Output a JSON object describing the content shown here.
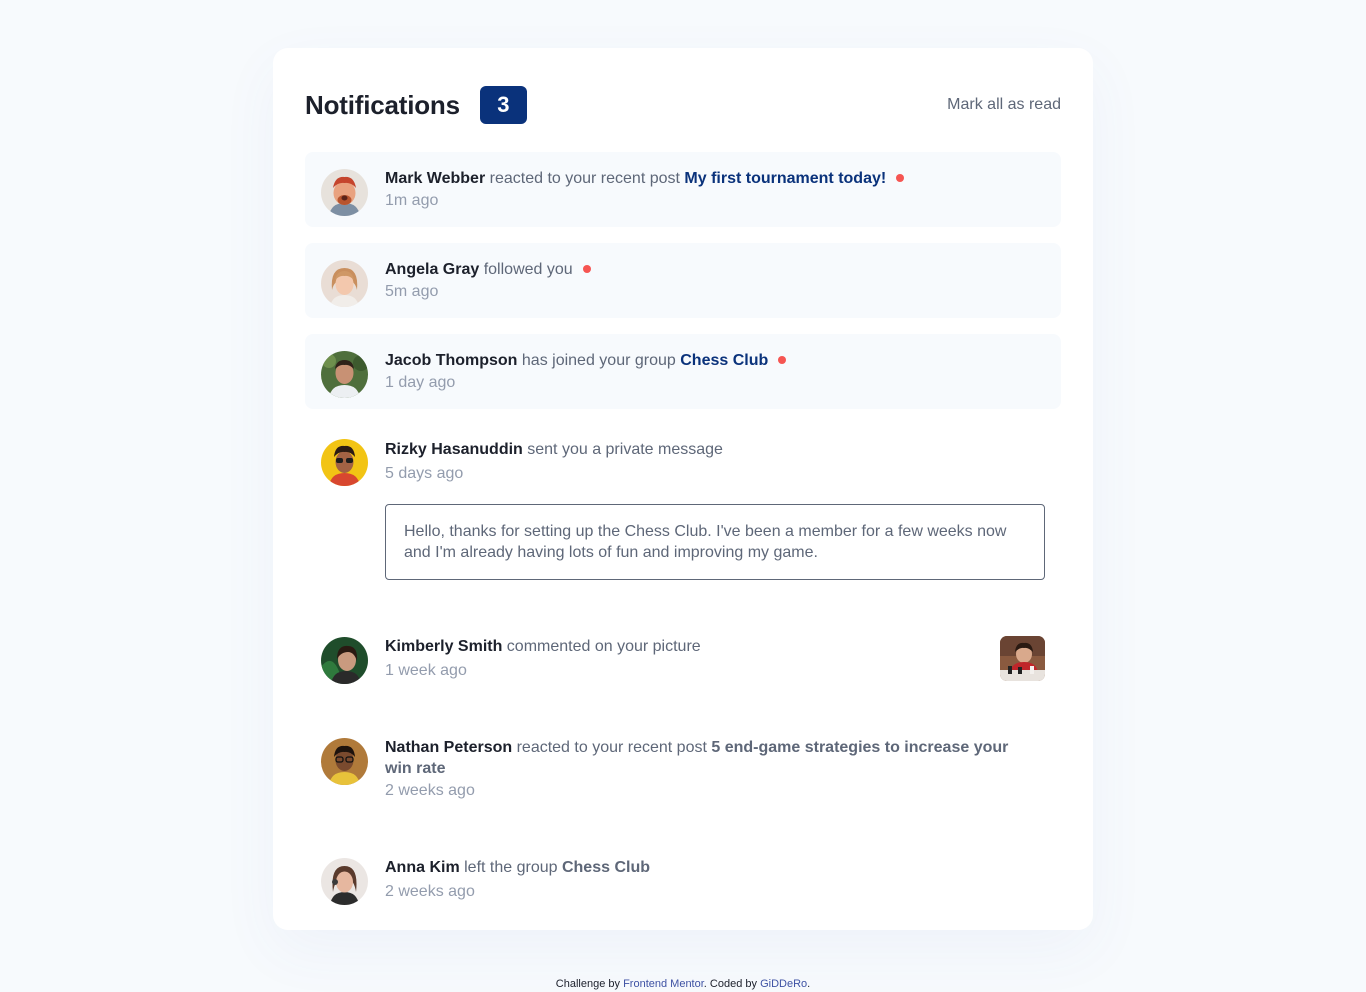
{
  "header": {
    "title": "Notifications",
    "unread_count": "3",
    "mark_all_label": "Mark all as read"
  },
  "notifications": [
    {
      "name": "Mark Webber",
      "action": " reacted to your recent post ",
      "target": "My first tournament today!",
      "time": "1m ago",
      "unread": true
    },
    {
      "name": "Angela Gray",
      "action": " followed you",
      "target": "",
      "time": "5m ago",
      "unread": true
    },
    {
      "name": "Jacob Thompson",
      "action": " has joined your group ",
      "target": "Chess Club",
      "time": "1 day ago",
      "unread": true
    },
    {
      "name": "Rizky Hasanuddin",
      "action": " sent you a private message",
      "target": "",
      "time": "5 days ago",
      "unread": false,
      "message": "Hello, thanks for setting up the Chess Club. I've been a member for a few weeks now and I'm already having lots of fun and improving my game."
    },
    {
      "name": "Kimberly Smith",
      "action": " commented on your picture",
      "target": "",
      "time": "1 week ago",
      "unread": false
    },
    {
      "name": "Nathan Peterson",
      "action": " reacted to your recent post ",
      "target": "5 end-game strategies to increase your win rate",
      "time": "2 weeks ago",
      "unread": false
    },
    {
      "name": "Anna Kim",
      "action": " left the group ",
      "target": "Chess Club",
      "time": "2 weeks ago",
      "unread": false
    }
  ],
  "footer": {
    "prefix": "Challenge by ",
    "link1": "Frontend Mentor",
    "middle": ". Coded by ",
    "link2": "GiDDeRo",
    "suffix": "."
  },
  "colors": {
    "background": "#f7fafd",
    "accent_navy": "#0a327b",
    "unread_dot": "#f65552",
    "text_dark": "#1c202b",
    "text_muted": "#5e6778",
    "text_light": "#939cad"
  }
}
